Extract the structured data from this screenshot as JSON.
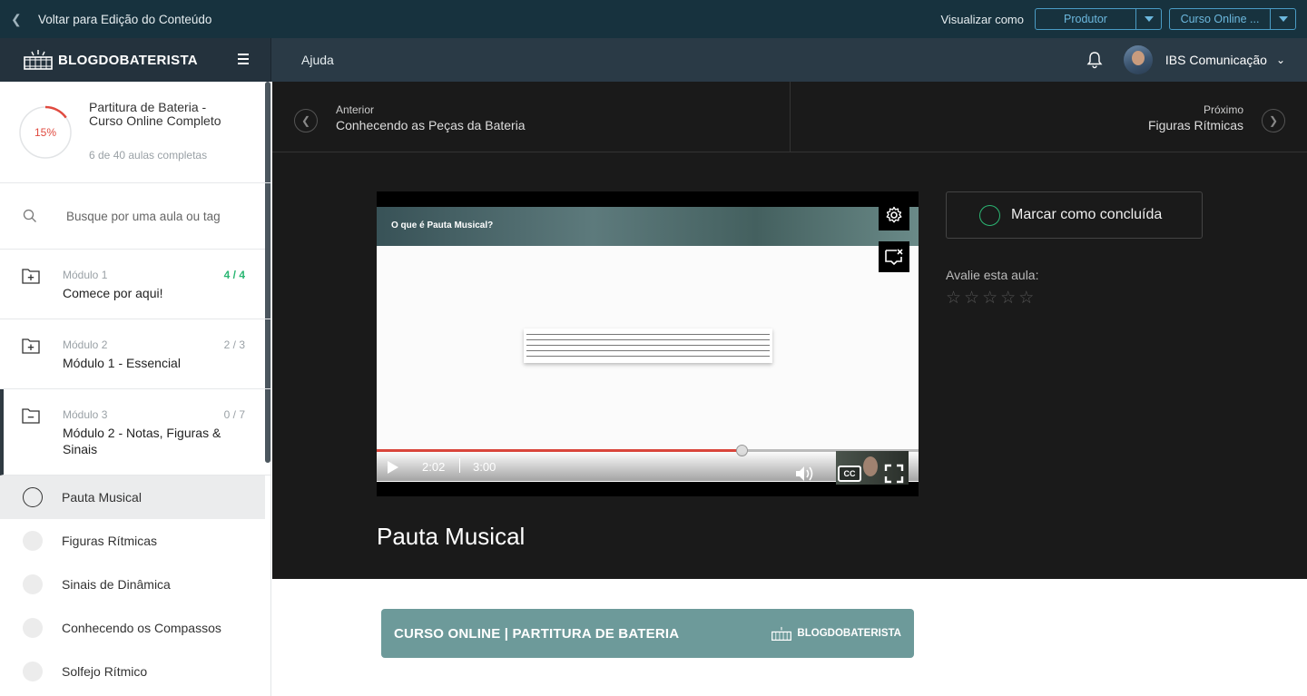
{
  "topbar": {
    "back_label": "Voltar para Edição do Conteúdo",
    "view_as_label": "Visualizar como",
    "role_value": "Produtor",
    "course_value": "Curso Online ..."
  },
  "header": {
    "logo_text": "BLOGDOBATERISTA",
    "help_label": "Ajuda",
    "user_name": "IBS Comunicação"
  },
  "course": {
    "progress": "15%",
    "progress_fraction": 0.15,
    "title": "Partitura de Bateria - Curso Online Completo",
    "subtitle": "6 de 40 aulas completas"
  },
  "search": {
    "placeholder": "Busque por uma aula ou tag"
  },
  "modules": [
    {
      "num": "Módulo 1",
      "title": "Comece por aqui!",
      "count": "4 / 4"
    },
    {
      "num": "Módulo 2",
      "title": "Módulo 1 - Essencial",
      "count": "2 / 3"
    },
    {
      "num": "Módulo 3",
      "title": "Módulo 2 - Notas, Figuras & Sinais",
      "count": "0 / 7"
    }
  ],
  "lessons": [
    {
      "title": "Pauta Musical"
    },
    {
      "title": "Figuras Rítmicas"
    },
    {
      "title": "Sinais de Dinâmica"
    },
    {
      "title": "Conhecendo os Compassos"
    },
    {
      "title": "Solfejo Rítmico"
    }
  ],
  "nav": {
    "prev_label": "Anterior",
    "prev_title": "Conhecendo as Peças da Bateria",
    "next_label": "Próximo",
    "next_title": "Figuras Rítmicas"
  },
  "video": {
    "overlay_title": "O que é Pauta Musical?",
    "current_time": "2:02",
    "duration": "3:00",
    "played_fraction": 0.673,
    "cc_label": "CC"
  },
  "lesson_actions": {
    "mark_complete": "Marcar como concluída",
    "rate_label": "Avalie esta aula:",
    "stars": 5
  },
  "lesson_title": "Pauta Musical",
  "banner": {
    "text": "CURSO ONLINE | PARTITURA DE BATERIA",
    "logo": "BLOGDOBATERISTA"
  },
  "colors": {
    "topbar": "#17323e",
    "header": "#2a3a46",
    "accent_blue": "#6cb8de",
    "progress_red": "#e04a3f",
    "complete_green": "#2bb673",
    "banner": "#6d9a9a"
  }
}
